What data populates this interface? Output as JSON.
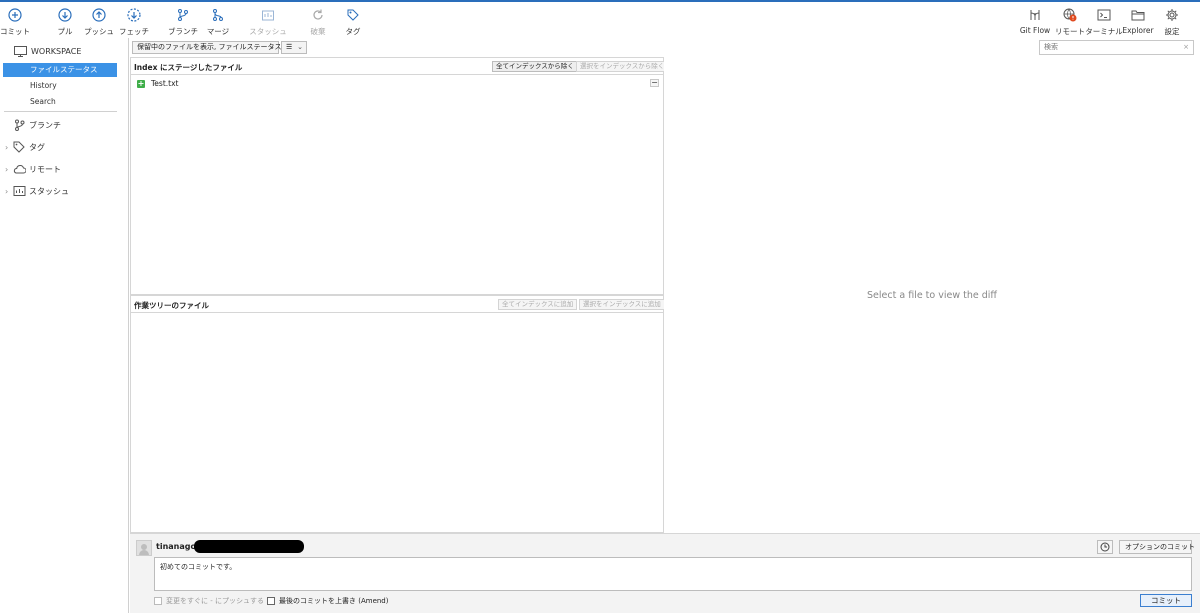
{
  "toolbar": {
    "left": [
      {
        "name": "commit-button",
        "label": "コミット",
        "icon": "plus-circle-icon",
        "enabled": true
      },
      {
        "name": "pull-button",
        "label": "プル",
        "icon": "arrow-down-circle-icon",
        "enabled": true
      },
      {
        "name": "push-button",
        "label": "プッシュ",
        "icon": "arrow-up-circle-icon",
        "enabled": true
      },
      {
        "name": "fetch-button",
        "label": "フェッチ",
        "icon": "dashed-arrow-down-circle-icon",
        "enabled": true
      },
      {
        "name": "branch-button",
        "label": "ブランチ",
        "icon": "branch-icon",
        "enabled": true
      },
      {
        "name": "merge-button",
        "label": "マージ",
        "icon": "merge-icon",
        "enabled": true
      },
      {
        "name": "stash-button",
        "label": "スタッシュ",
        "icon": "stash-icon",
        "enabled": false
      },
      {
        "name": "discard-button",
        "label": "破棄",
        "icon": "discard-icon",
        "enabled": false
      },
      {
        "name": "tag-button",
        "label": "タグ",
        "icon": "tag-icon",
        "enabled": true
      }
    ],
    "right": [
      {
        "name": "git-flow-button",
        "label": "Git Flow",
        "icon": "git-flow-icon"
      },
      {
        "name": "remote-button",
        "label": "リモート",
        "icon": "globe-alert-icon"
      },
      {
        "name": "terminal-button",
        "label": "ターミナル",
        "icon": "terminal-icon"
      },
      {
        "name": "explorer-button",
        "label": "Explorer",
        "icon": "folder-icon"
      },
      {
        "name": "settings-button",
        "label": "設定",
        "icon": "gear-icon"
      }
    ]
  },
  "sidebar": {
    "workspace_label": "WORKSPACE",
    "items": [
      {
        "label": "ファイルステータス",
        "active": true
      },
      {
        "label": "History",
        "active": false
      },
      {
        "label": "Search",
        "active": false
      }
    ],
    "groups": [
      {
        "label": "ブランチ",
        "icon": "branch-icon",
        "expandable": false
      },
      {
        "label": "タグ",
        "icon": "tag-icon",
        "expandable": true
      },
      {
        "label": "リモート",
        "icon": "cloud-icon",
        "expandable": true
      },
      {
        "label": "スタッシュ",
        "icon": "stash-icon",
        "expandable": true
      }
    ]
  },
  "filter": {
    "dropdown_label": "保留中のファイルを表示, ファイルステータス順",
    "view_label": "☰"
  },
  "search": {
    "placeholder": "検索"
  },
  "staged": {
    "title": "Index にステージしたファイル",
    "unstage_all": "全てインデックスから除く",
    "unstage_selected": "選択をインデックスから除く",
    "files": [
      {
        "name": "Test.txt",
        "status": "added"
      }
    ]
  },
  "working": {
    "title": "作業ツリーのファイル",
    "stage_all": "全てインデックスに追加",
    "stage_selected": "選択をインデックスに追加"
  },
  "diff": {
    "message": "Select a file to view the diff"
  },
  "commit": {
    "author": "tinanago",
    "message": "初めてのコミットです。",
    "push_immediately": "変更をすぐに - にプッシュする",
    "amend": "最後のコミットを上書き (Amend)",
    "options_label": "オプションのコミット",
    "commit_label": "コミット"
  },
  "colors": {
    "accent": "#3b92e6",
    "add_status": "#3fae49",
    "alert": "#e04a1f"
  }
}
